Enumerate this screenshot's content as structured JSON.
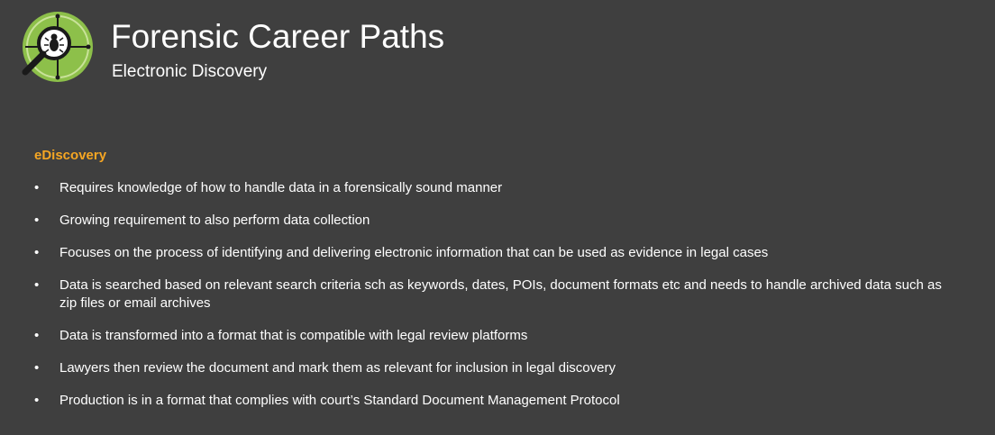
{
  "header": {
    "title": "Forensic Career Paths",
    "subtitle": "Electronic Discovery",
    "logo_icon": "magnifier-bug-icon"
  },
  "section": {
    "heading": "eDiscovery",
    "bullet_glyph": "•",
    "items": [
      "Requires knowledge of how to handle data in a forensically sound manner",
      "Growing requirement to also perform data collection",
      "Focuses on the process of identifying and delivering electronic information that can be used as evidence in legal cases",
      "Data is searched based on relevant search criteria sch as keywords, dates, POIs, document formats etc and needs to handle archived data such as zip files or email archives",
      "Data is transformed into a format that is compatible with legal review platforms",
      "Lawyers then review the document and mark them as relevant for inclusion in legal discovery",
      "Production is in a format that complies with court’s Standard Document Management Protocol"
    ]
  },
  "colors": {
    "background": "#3f3f3f",
    "accent": "#f5a623",
    "logo_green": "#8dc04a",
    "text": "#ffffff"
  }
}
